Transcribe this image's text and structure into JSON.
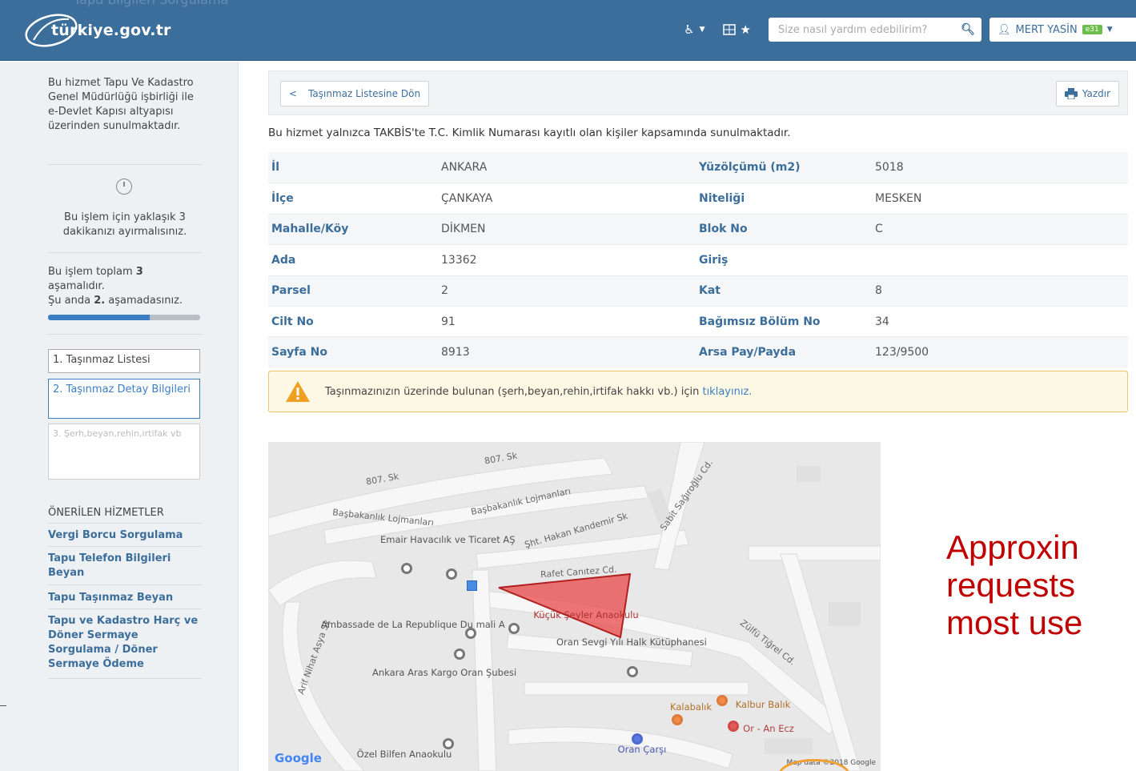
{
  "header": {
    "ghost_title": "Tapu Bilgileri Sorgulama",
    "logo_text": "türkiye.gov.tr",
    "accessibility_label": "♿",
    "search": {
      "placeholder": "Size nasıl yardım edebilirim?"
    },
    "user": {
      "name": "MERT YASİN",
      "badge": "e31"
    }
  },
  "sidebar": {
    "intro": "Bu hizmet Tapu Ve Kadastro Genel Müdürlüğü işbirliği ile e-Devlet Kapısı altyapısı üzerinden sunulmaktadır.",
    "time_note": "Bu işlem için yaklaşık 3 dakikanızı ayırmalısınız.",
    "steps_total_prefix": "Bu işlem toplam ",
    "steps_total": "3",
    "steps_total_suffix": " aşamalıdır.",
    "current_prefix": "Şu anda ",
    "current_step": "2.",
    "current_suffix": " aşamadasınız.",
    "progress_fraction": 0.67,
    "steps": [
      {
        "label": "1. Taşınmaz Listesi"
      },
      {
        "label": "2. Taşınmaz Detay Bilgileri"
      },
      {
        "label": "3. Şerh,beyan,rehin,irtifak vb"
      }
    ],
    "recommended_title": "ÖNERİLEN HİZMETLER",
    "recommended": [
      {
        "label": "Vergi Borcu Sorgulama"
      },
      {
        "label": "Tapu Telefon Bilgileri Beyan"
      },
      {
        "label": "Tapu Taşınmaz Beyan"
      },
      {
        "label": "Tapu ve Kadastro Harç ve Döner Sermaye Sorgulama / Döner Sermaye Ödeme"
      }
    ]
  },
  "main": {
    "back_label": "Taşınmaz Listesine Dön",
    "print_label": "Yazdır",
    "info": "Bu hizmet yalnızca TAKBİS'te T.C. Kimlik Numarası kayıtlı olan kişiler kapsamında sunulmaktadır.",
    "rows": [
      {
        "l1": "İl",
        "v1": "ANKARA",
        "l2": "Yüzölçümü (m2)",
        "v2": "5018"
      },
      {
        "l1": "İlçe",
        "v1": "ÇANKAYA",
        "l2": "Niteliği",
        "v2": "MESKEN"
      },
      {
        "l1": "Mahalle/Köy",
        "v1": "DİKMEN",
        "l2": "Blok No",
        "v2": "C"
      },
      {
        "l1": "Ada",
        "v1": "13362",
        "l2": "Giriş",
        "v2": ""
      },
      {
        "l1": "Parsel",
        "v1": "2",
        "l2": "Kat",
        "v2": "8"
      },
      {
        "l1": "Cilt No",
        "v1": "91",
        "l2": "Bağımsız Bölüm No",
        "v2": "34"
      },
      {
        "l1": "Sayfa No",
        "v1": "8913",
        "l2": "Arsa Pay/Payda",
        "v2": "123/9500"
      }
    ],
    "warning_text": "Taşınmazınızın üzerinde bulunan (şerh,beyan,rehin,irtifak hakkı vb.) için ",
    "warning_link": "tıklayınız."
  },
  "map": {
    "streets": [
      "807. Sk",
      "807. Sk",
      "Başbakanlık Lojmanları",
      "Başbakanlık Lojmanları",
      "Şht. Hakan Kandemir Sk",
      "Sabit Sağıroğlu Cd.",
      "Rafet Canıtez Cd.",
      "Zülfü Tiğrel Cd.",
      "Arif Nihat Asya Sk"
    ],
    "places": [
      "Emair Havacılık ve Ticaret AŞ",
      "Ambassade de La Republique Du mali A",
      "Küçük Şeyler Anaokulu",
      "Oran Sevgi Yılı Halk Kütüphanesi",
      "Ankara Aras Kargo Oran Şubesi",
      "Kalabalık",
      "Kalbur Balık",
      "Or - An Ecz",
      "Oran Çarşı",
      "Özel Bilfen Anaokulu"
    ],
    "google": "Google",
    "attribution": "Map data ©2018 Google",
    "parcel_color": "#e84848"
  },
  "overlay": {
    "line1": "Approxin",
    "line2": "requests",
    "line3": "most use"
  },
  "colors": {
    "header": "#3c6e9c",
    "accent": "#3c7ec4"
  }
}
